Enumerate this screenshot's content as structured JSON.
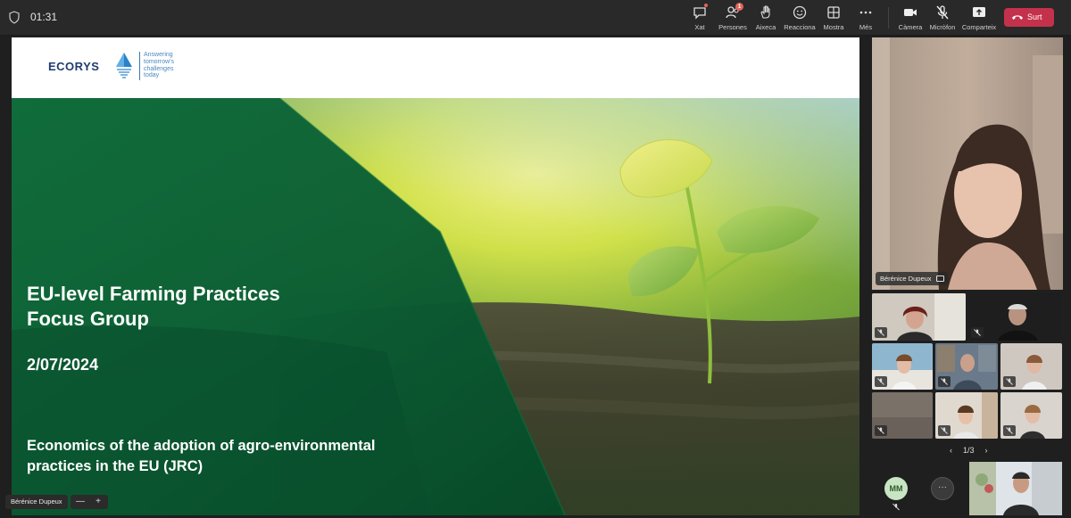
{
  "topbar": {
    "timer": "01:31",
    "buttons": [
      {
        "label": "Xat",
        "icon": "chat-icon"
      },
      {
        "label": "Persones",
        "icon": "people-icon",
        "badge": "1"
      },
      {
        "label": "Aixeca",
        "icon": "raise-hand-icon"
      },
      {
        "label": "Reacciona",
        "icon": "smile-icon"
      },
      {
        "label": "Mostra",
        "icon": "grid-icon"
      },
      {
        "label": "Més",
        "icon": "more-icon"
      },
      {
        "label": "Càmera",
        "icon": "camera-icon"
      },
      {
        "label": "Micròfon",
        "icon": "mic-off-icon"
      },
      {
        "label": "Comparteix",
        "icon": "share-icon"
      }
    ],
    "leave_label": "Surt",
    "leave_color": "#c4314b"
  },
  "slide": {
    "logo_word": "ECORYS",
    "logo_tagline": [
      "Answering",
      "tomorrow's",
      "challenges",
      "today"
    ],
    "title_line1": "EU-level Farming Practices",
    "title_line2": "Focus Group",
    "date": "2/07/2024",
    "subtitle_line1": "Economics of the adoption of agro-environmental",
    "subtitle_line2": "practices in the EU (JRC)",
    "presenter": "Bérénice Dupeux",
    "zoom_minus": "—",
    "zoom_plus": "+"
  },
  "participants": {
    "main_speaker": "Bérénice Dupeux",
    "pager": "1/3",
    "pager_prev": "‹",
    "pager_next": "›",
    "avatar_initials": "MM",
    "more_label": "···"
  }
}
